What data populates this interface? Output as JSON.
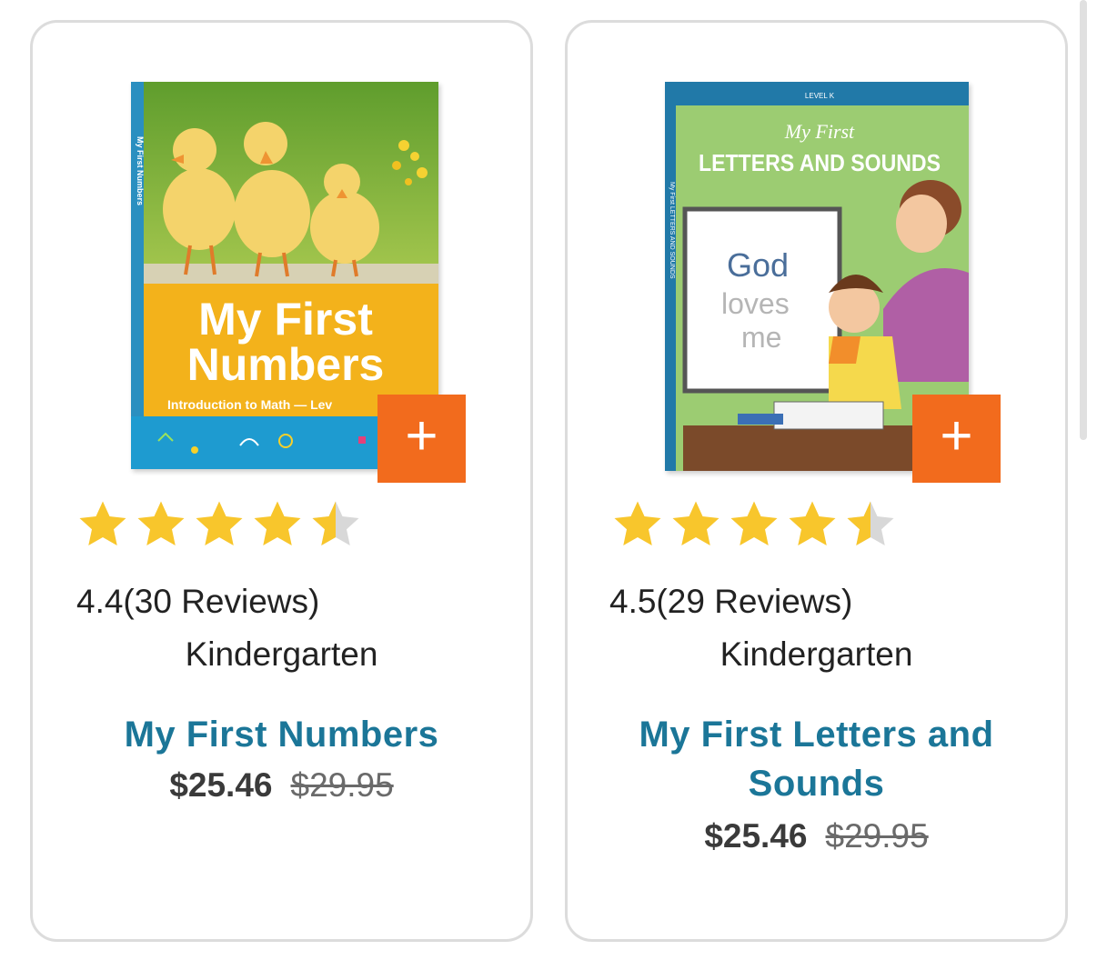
{
  "products": [
    {
      "cover": {
        "spine_text": "My First Numbers",
        "title_line1": "My First",
        "title_line2": "Numbers",
        "subtitle": "Introduction to Math — Lev"
      },
      "add_label": "+",
      "rating_fraction": 0.88,
      "rating_text": "4.4(30 Reviews)",
      "grade": "Kindergarten",
      "title": "My First Numbers",
      "price": "$25.46",
      "original_price": "$29.95"
    },
    {
      "cover": {
        "level": "LEVEL K",
        "title_script": "My First",
        "title_main": "LETTERS AND SOUNDS",
        "spine_text": "My First LETTERS AND SOUNDS",
        "board_line1": "God",
        "board_line2": "loves",
        "board_line3": "me"
      },
      "add_label": "+",
      "rating_fraction": 0.9,
      "rating_text": "4.5(29 Reviews)",
      "grade": "Kindergarten",
      "title": "My First Letters and Sounds",
      "price": "$25.46",
      "original_price": "$29.95"
    }
  ],
  "colors": {
    "title": "#1b7698",
    "star_filled": "#f8c62c",
    "star_empty": "#d8d8d8",
    "add_button": "#f26b1d",
    "card_border": "#dcdcdc"
  }
}
